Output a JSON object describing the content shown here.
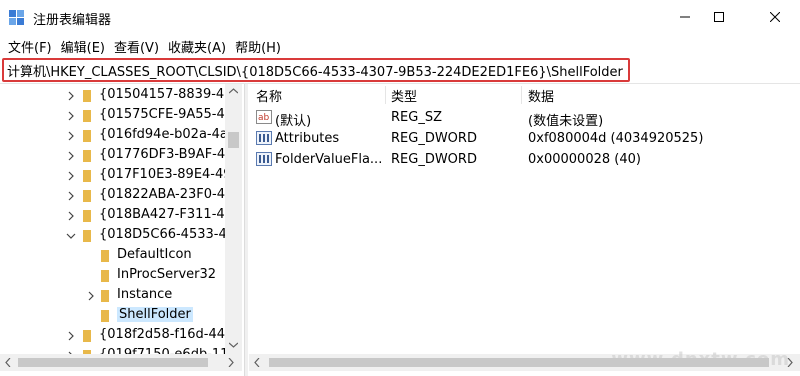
{
  "window": {
    "title": "注册表编辑器",
    "controls": [
      "minimize",
      "maximize",
      "close"
    ]
  },
  "menu": {
    "items": [
      "文件(F)",
      "编辑(E)",
      "查看(V)",
      "收藏夹(A)",
      "帮助(H)"
    ]
  },
  "address": {
    "path": "计算机\\HKEY_CLASSES_ROOT\\CLSID\\{018D5C66-4533-4307-9B53-224DE2ED1FE6}\\ShellFolder"
  },
  "tree": {
    "items": [
      {
        "label": "{01504157-8839-4I",
        "expanded": false
      },
      {
        "label": "{01575CFE-9A55-4(",
        "expanded": false
      },
      {
        "label": "{016fd94e-b02a-4a",
        "expanded": false
      },
      {
        "label": "{01776DF3-B9AF-4",
        "expanded": false
      },
      {
        "label": "{017F10E3-89E4-49",
        "expanded": false
      },
      {
        "label": "{01822ABA-23F0-4",
        "expanded": false
      },
      {
        "label": "{018BA427-F311-4",
        "expanded": false
      },
      {
        "label": "{018D5C66-4533-4",
        "expanded": true
      },
      {
        "label": "DefaultIcon",
        "child": true
      },
      {
        "label": "InProcServer32",
        "child": true
      },
      {
        "label": "Instance",
        "child": true,
        "expandable": true
      },
      {
        "label": "ShellFolder",
        "child": true,
        "selected": true
      },
      {
        "label": "{018f2d58-f16d-44",
        "expanded": false
      },
      {
        "label": "{019f7150-e6db-11",
        "expanded": false
      }
    ]
  },
  "values_pane": {
    "columns": {
      "name": "名称",
      "type": "类型",
      "data": "数据"
    },
    "rows": [
      {
        "icon": "string-value-icon",
        "name": "(默认)",
        "type": "REG_SZ",
        "data": "(数值未设置)"
      },
      {
        "icon": "dword-value-icon",
        "name": "Attributes",
        "type": "REG_DWORD",
        "data": "0xf080004d (4034920525)"
      },
      {
        "icon": "dword-value-icon",
        "name": "FolderValueFla...",
        "type": "REG_DWORD",
        "data": "0x00000028 (40)"
      }
    ]
  },
  "watermark": {
    "text": "www.dnxtw.com"
  },
  "colors": {
    "selection": "#cce8ff",
    "address_highlight": "#d93a3a",
    "folder": "#e8b84a"
  }
}
